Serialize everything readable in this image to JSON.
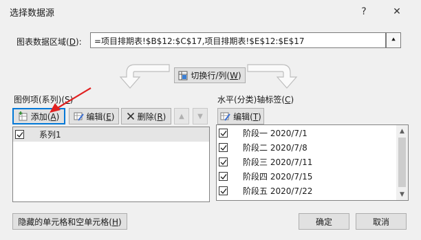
{
  "window": {
    "title": "选择数据源",
    "help_glyph": "?",
    "close_glyph": "✕"
  },
  "data_range": {
    "label_prefix": "图表数据区域(",
    "label_key": "D",
    "label_suffix": "):",
    "value": "=项目排期表!$B$12:$C$17,项目排期表!$E$12:$E$17",
    "collapse_glyph": "⯅"
  },
  "switch_button": {
    "label_prefix": "切换行/列(",
    "label_key": "W",
    "label_suffix": ")"
  },
  "series_panel": {
    "heading_prefix": "图例项(系列)(",
    "heading_key": "S",
    "heading_suffix": ")",
    "add_prefix": "添加(",
    "add_key": "A",
    "add_suffix": ")",
    "edit_prefix": "编辑(",
    "edit_key": "E",
    "edit_suffix": ")",
    "delete_prefix": "删除(",
    "delete_key": "R",
    "delete_suffix": ")",
    "move_up_glyph": "▲",
    "move_down_glyph": "▼",
    "items": [
      {
        "label": "系列1",
        "checked": true
      }
    ]
  },
  "axis_panel": {
    "heading_prefix": "水平(分类)轴标签(",
    "heading_key": "C",
    "heading_suffix": ")",
    "edit_prefix": "编辑(",
    "edit_key": "T",
    "edit_suffix": ")",
    "items": [
      {
        "label": "阶段一 2020/7/1",
        "checked": true
      },
      {
        "label": "阶段二 2020/7/8",
        "checked": true
      },
      {
        "label": "阶段三 2020/7/11",
        "checked": true
      },
      {
        "label": "阶段四 2020/7/15",
        "checked": true
      },
      {
        "label": "阶段五 2020/7/22",
        "checked": true
      }
    ],
    "scroll_up_glyph": "▲",
    "scroll_down_glyph": "▼"
  },
  "footer": {
    "hidden_cells_prefix": "隐藏的单元格和空单元格(",
    "hidden_cells_key": "H",
    "hidden_cells_suffix": ")",
    "ok_label": "确定",
    "cancel_label": "取消"
  },
  "colors": {
    "accent": "#0078d7",
    "annotation_arrow": "#e02020",
    "dialog_bg": "#f0f0f0",
    "selected_row": "#e5e5e5"
  }
}
